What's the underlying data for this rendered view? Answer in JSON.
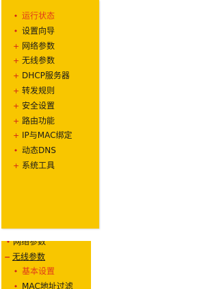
{
  "colors": {
    "panel_bg": "#f8c600",
    "bullet": "#d0201a",
    "active_text": "#e03a1a",
    "text": "#1a1a1a"
  },
  "menu": {
    "items": [
      {
        "label": "运行状态",
        "bullet": "•",
        "active": true
      },
      {
        "label": "设置向导",
        "bullet": "•"
      },
      {
        "label": "网络参数",
        "bullet": "+"
      },
      {
        "label": "无线参数",
        "bullet": "+"
      },
      {
        "label": "DHCP服务器",
        "bullet": "+"
      },
      {
        "label": "转发规则",
        "bullet": "+"
      },
      {
        "label": "安全设置",
        "bullet": "+"
      },
      {
        "label": "路由功能",
        "bullet": "+"
      },
      {
        "label": "IP与MAC绑定",
        "bullet": "+"
      },
      {
        "label": "动态DNS",
        "bullet": "•"
      },
      {
        "label": "系统工具",
        "bullet": "+"
      }
    ]
  },
  "submenu": {
    "items": [
      {
        "label": "网络参数",
        "bullet": "•"
      },
      {
        "label": "无线参数",
        "bullet": "−"
      },
      {
        "label": "基本设置",
        "bullet": "•"
      },
      {
        "label": "MAC地址过滤",
        "bullet": "•"
      }
    ]
  }
}
